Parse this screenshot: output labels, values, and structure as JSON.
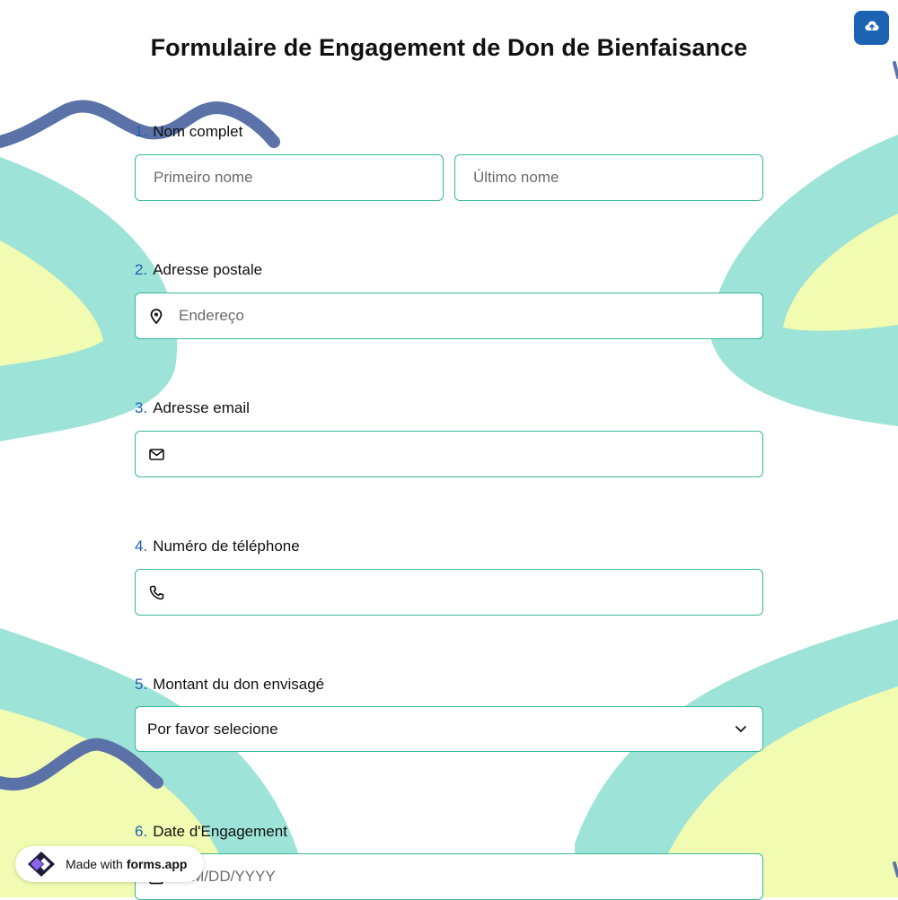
{
  "form": {
    "title": "Formulaire de Engagement de Don de Bienfaisance",
    "upload_icon": "cloud-upload-icon",
    "accent_color": "#1d63b4",
    "border_color": "#3ab79a"
  },
  "questions": [
    {
      "number": "1.",
      "label": "Nom complet",
      "first_placeholder": "Primeiro nome",
      "last_placeholder": "Último nome"
    },
    {
      "number": "2.",
      "label": "Adresse postale",
      "placeholder": "Endereço",
      "icon": "map-pin-icon"
    },
    {
      "number": "3.",
      "label": "Adresse email",
      "placeholder": "",
      "icon": "envelope-icon"
    },
    {
      "number": "4.",
      "label": "Numéro de téléphone",
      "placeholder": "",
      "icon": "phone-icon"
    },
    {
      "number": "5.",
      "label": "Montant du don envisagé",
      "selected": "Por favor selecione",
      "icon": "chevron-down-icon"
    },
    {
      "number": "6.",
      "label": "Date d'Engagement",
      "placeholder": "MM/DD/YYYY",
      "icon": "calendar-icon"
    }
  ],
  "badge": {
    "prefix": "Made with",
    "brand": "forms.app"
  }
}
